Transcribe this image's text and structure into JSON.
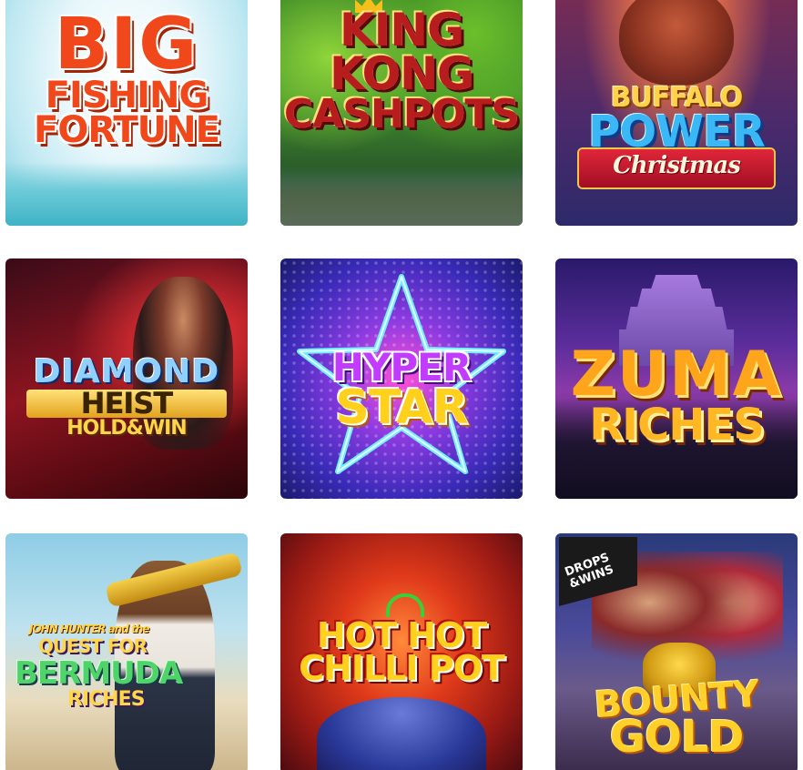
{
  "games": [
    {
      "id": "big-fishing-fortune",
      "lines": [
        "BIG",
        "FISHING",
        "FORTUNE"
      ]
    },
    {
      "id": "king-kong-cashpots",
      "lines": [
        "KING",
        "KONG",
        "CASHPOTS"
      ]
    },
    {
      "id": "buffalo-power-christmas",
      "lines": [
        "BUFFALO",
        "POWER",
        "Christmas"
      ]
    },
    {
      "id": "diamond-heist",
      "lines": [
        "DIAMOND",
        "HEIST",
        "HOLD&WIN"
      ]
    },
    {
      "id": "hyper-star",
      "lines": [
        "HYPER",
        "STAR"
      ]
    },
    {
      "id": "zuma-riches",
      "lines": [
        "ZUMA",
        "RICHES"
      ]
    },
    {
      "id": "john-hunter-bermuda-riches",
      "lines": [
        "JOHN HUNTER and the",
        "QUEST FOR",
        "BERMUDA",
        "RICHES"
      ]
    },
    {
      "id": "hot-hot-chilli-pot",
      "lines": [
        "HOT HOT",
        "CHILLI POT"
      ]
    },
    {
      "id": "bounty-gold",
      "lines": [
        "BOUNTY",
        "GOLD"
      ],
      "badge": [
        "DROPS",
        "&WINS"
      ]
    }
  ]
}
